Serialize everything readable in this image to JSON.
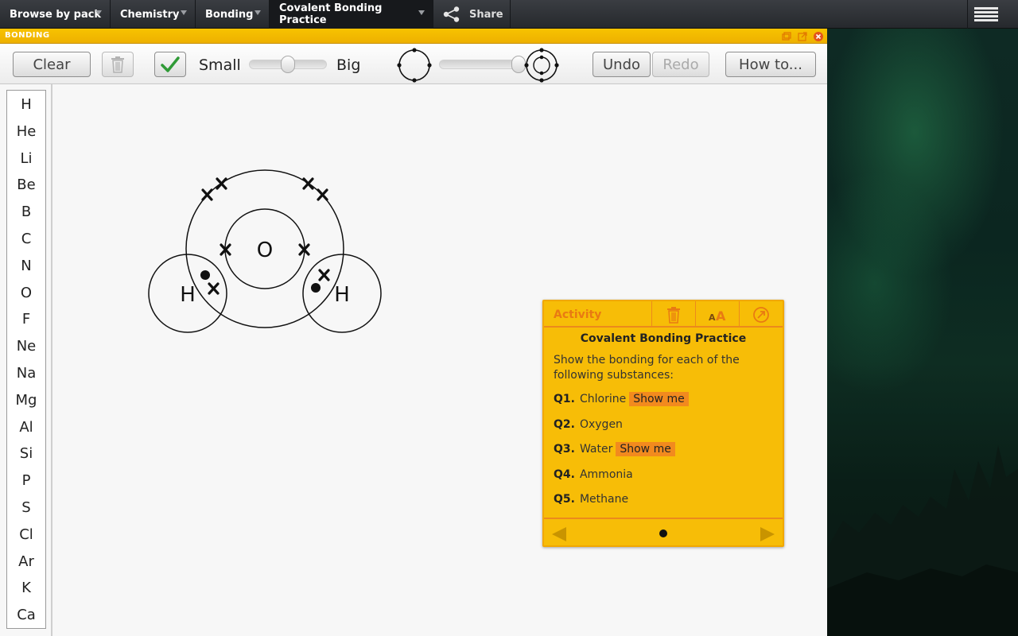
{
  "topbar": {
    "crumbs": [
      "Browse by pack",
      "Chemistry",
      "Bonding",
      "Covalent Bonding Practice"
    ],
    "share_label": "Share"
  },
  "window": {
    "title": "BONDING"
  },
  "toolbar": {
    "clear_label": "Clear",
    "small_label": "Small",
    "big_label": "Big",
    "undo_label": "Undo",
    "redo_label": "Redo",
    "howto_label": "How to...",
    "size_slider_value": 0.5,
    "shell_slider_value": 1.0
  },
  "palette": {
    "elements": [
      "H",
      "He",
      "Li",
      "Be",
      "B",
      "C",
      "N",
      "O",
      "F",
      "Ne",
      "Na",
      "Mg",
      "Al",
      "Si",
      "P",
      "S",
      "Cl",
      "Ar",
      "K",
      "Ca"
    ]
  },
  "diagram": {
    "center_atom": "O",
    "left_atom": "H",
    "right_atom": "H"
  },
  "activity": {
    "header": "Activity",
    "heading": "Covalent Bonding Practice",
    "intro": "Show the bonding for each of the following substances:",
    "questions": [
      {
        "num": "Q1.",
        "text": "Chlorine",
        "show_me": "Show me"
      },
      {
        "num": "Q2.",
        "text": "Oxygen"
      },
      {
        "num": "Q3.",
        "text": "Water",
        "show_me": "Show me"
      },
      {
        "num": "Q4.",
        "text": "Ammonia"
      },
      {
        "num": "Q5.",
        "text": "Methane"
      }
    ]
  },
  "colors": {
    "titlebar": "#f5bd00",
    "activity_bg": "#f7bd07",
    "activity_accent": "#ec8a1c",
    "show_me_bg": "#f28a1e"
  }
}
